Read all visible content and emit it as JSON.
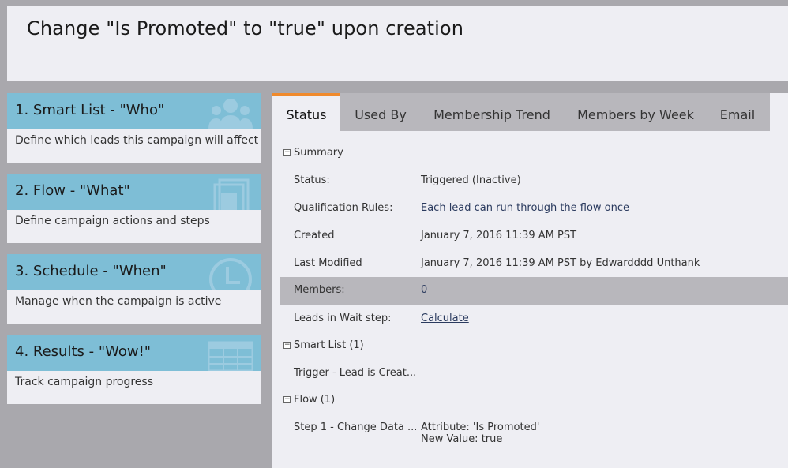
{
  "header": {
    "title": "Change \"Is Promoted\" to \"true\" upon creation"
  },
  "cards": [
    {
      "title": "1. Smart List - \"Who\"",
      "desc": "Define which leads this campaign will affect",
      "icon": "people-icon"
    },
    {
      "title": "2. Flow - \"What\"",
      "desc": "Define campaign actions and steps",
      "icon": "stacked-pages-icon"
    },
    {
      "title": "3. Schedule - \"When\"",
      "desc": "Manage when the campaign is active",
      "icon": "clock-icon"
    },
    {
      "title": "4. Results - \"Wow!\"",
      "desc": "Track campaign progress",
      "icon": "table-grid-icon"
    }
  ],
  "tabs": [
    "Status",
    "Used By",
    "Membership Trend",
    "Members by Week",
    "Email"
  ],
  "active_tab": "Status",
  "summary": {
    "section_label": "Summary",
    "status_label": "Status:",
    "status_value": "Triggered (Inactive)",
    "qual_label": "Qualification Rules:",
    "qual_value": "Each lead can run through the flow once",
    "created_label": "Created",
    "created_value": "January 7, 2016 11:39 AM PST",
    "modified_label": "Last Modified",
    "modified_value": "January 7, 2016 11:39 AM PST by Edwardddd Unthank",
    "members_label": "Members:",
    "members_value": "0",
    "wait_label": "Leads in Wait step:",
    "wait_value": "Calculate"
  },
  "smart_list": {
    "section_label": "Smart List (1)",
    "trigger_label": "Trigger - Lead is Creat..."
  },
  "flow": {
    "section_label": "Flow (1)",
    "step_label": "Step 1 - Change Data ...",
    "attr_line": "Attribute: 'Is Promoted'",
    "value_line": "New Value: true"
  },
  "colors": {
    "accent": "#f08a2c",
    "card_header": "#7ebed6",
    "background": "#a9a8ad"
  }
}
